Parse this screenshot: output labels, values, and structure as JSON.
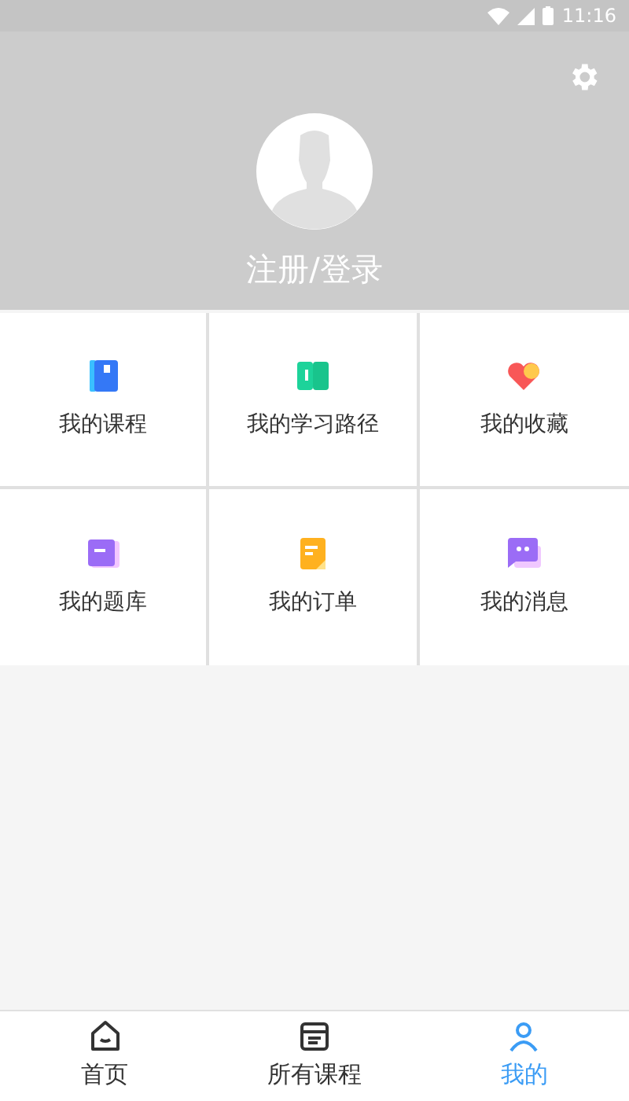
{
  "status_bar": {
    "time": "11:16"
  },
  "profile": {
    "login_label": "注册/登录"
  },
  "menu": [
    {
      "label": "我的课程",
      "kind": "course"
    },
    {
      "label": "我的学习路径",
      "kind": "path"
    },
    {
      "label": "我的收藏",
      "kind": "favorite"
    },
    {
      "label": "我的题库",
      "kind": "questions"
    },
    {
      "label": "我的订单",
      "kind": "order"
    },
    {
      "label": "我的消息",
      "kind": "message"
    }
  ],
  "bottom_nav": [
    {
      "label": "首页",
      "kind": "home",
      "selected": false
    },
    {
      "label": "所有课程",
      "kind": "courses",
      "selected": false
    },
    {
      "label": "我的",
      "kind": "me",
      "selected": true
    }
  ]
}
